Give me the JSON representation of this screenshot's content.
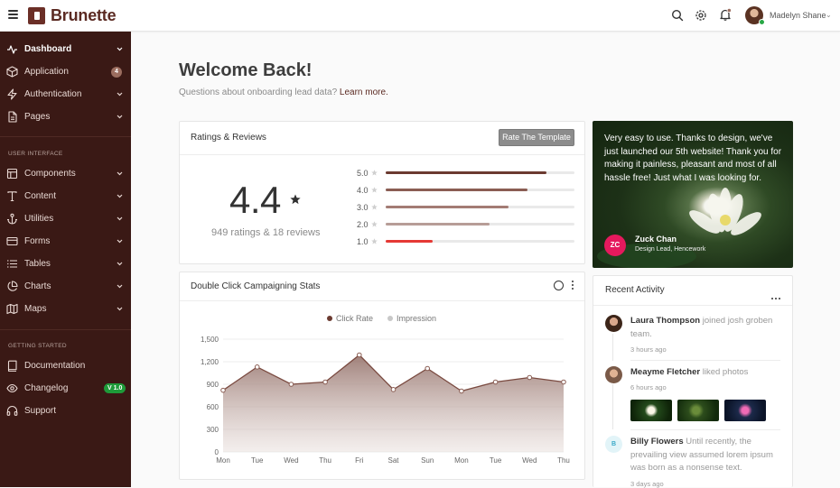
{
  "app": {
    "brand": "Brunette"
  },
  "topbar": {
    "user_name": "Madelyn Shane"
  },
  "sidebar": {
    "items": [
      {
        "label": "Dashboard",
        "icon": "activity-icon"
      },
      {
        "label": "Application",
        "icon": "package-icon",
        "badge": "4"
      },
      {
        "label": "Authentication",
        "icon": "zap-icon"
      },
      {
        "label": "Pages",
        "icon": "file-text-icon"
      }
    ],
    "section_ui": "USER INTERFACE",
    "ui_items": [
      {
        "label": "Components",
        "icon": "layout-icon"
      },
      {
        "label": "Content",
        "icon": "type-icon"
      },
      {
        "label": "Utilities",
        "icon": "anchor-icon"
      },
      {
        "label": "Forms",
        "icon": "credit-card-icon"
      },
      {
        "label": "Tables",
        "icon": "list-icon"
      },
      {
        "label": "Charts",
        "icon": "pie-chart-icon"
      },
      {
        "label": "Maps",
        "icon": "map-icon"
      }
    ],
    "section_start": "GETTING STARTED",
    "start_items": [
      {
        "label": "Documentation",
        "icon": "book-icon"
      },
      {
        "label": "Changelog",
        "icon": "eye-icon",
        "badge": "V 1.0"
      },
      {
        "label": "Support",
        "icon": "headphones-icon"
      }
    ]
  },
  "main": {
    "welcome": "Welcome Back!",
    "subtitle": "Questions about onboarding lead data?",
    "subtitle_link": "Learn more."
  },
  "ratings": {
    "title": "Ratings & Reviews",
    "button": "Rate The Template",
    "score": "4.4",
    "summary": "949 ratings & 18 reviews",
    "rows": [
      {
        "label": "5.0",
        "fill": 0.85,
        "color": "#6b3a30"
      },
      {
        "label": "4.0",
        "fill": 0.75,
        "color": "#8a5d53"
      },
      {
        "label": "3.0",
        "fill": 0.65,
        "color": "#a37c74"
      },
      {
        "label": "2.0",
        "fill": 0.55,
        "color": "#b79d97"
      },
      {
        "label": "1.0",
        "fill": 0.25,
        "color": "#e53935"
      }
    ]
  },
  "testimonial": {
    "quote": "Very easy to use. Thanks to design, we've just launched our 5th website! Thank you for making it painless, pleasant and most of all hassle free! Just what I was looking for.",
    "initials": "ZC",
    "name": "Zuck Chan",
    "role": "Design Lead, Hencework"
  },
  "stats": {
    "title": "Double Click Campaigning Stats",
    "legend": [
      "Click Rate",
      "Impression"
    ]
  },
  "chart_data": {
    "type": "area",
    "title": "Double Click Campaigning Stats",
    "categories": [
      "Mon",
      "Tue",
      "Wed",
      "Thu",
      "Fri",
      "Sat",
      "Sun",
      "Mon",
      "Tue",
      "Wed",
      "Thu"
    ],
    "series": [
      {
        "name": "Click Rate",
        "values": [
          820,
          1130,
          900,
          930,
          1290,
          830,
          1110,
          810,
          930,
          990,
          930
        ],
        "color": "#6b3a30"
      }
    ],
    "yticks": [
      "1,500",
      "1,200",
      "900",
      "600",
      "300",
      "0"
    ],
    "ylim": [
      0,
      1500
    ],
    "grid": true,
    "legend": "top-center"
  },
  "activity": {
    "title": "Recent Activity",
    "items": [
      {
        "name": "Laura Thompson",
        "text": "joined josh groben team.",
        "time": "3 hours ago"
      },
      {
        "name": "Meayme Fletcher",
        "text": "liked photos",
        "time": "6 hours ago"
      },
      {
        "name": "Billy Flowers",
        "initial": "B",
        "text": "Until recently, the prevailing view assumed lorem ipsum was born as a nonsense text.",
        "time": "3 days ago"
      }
    ]
  }
}
